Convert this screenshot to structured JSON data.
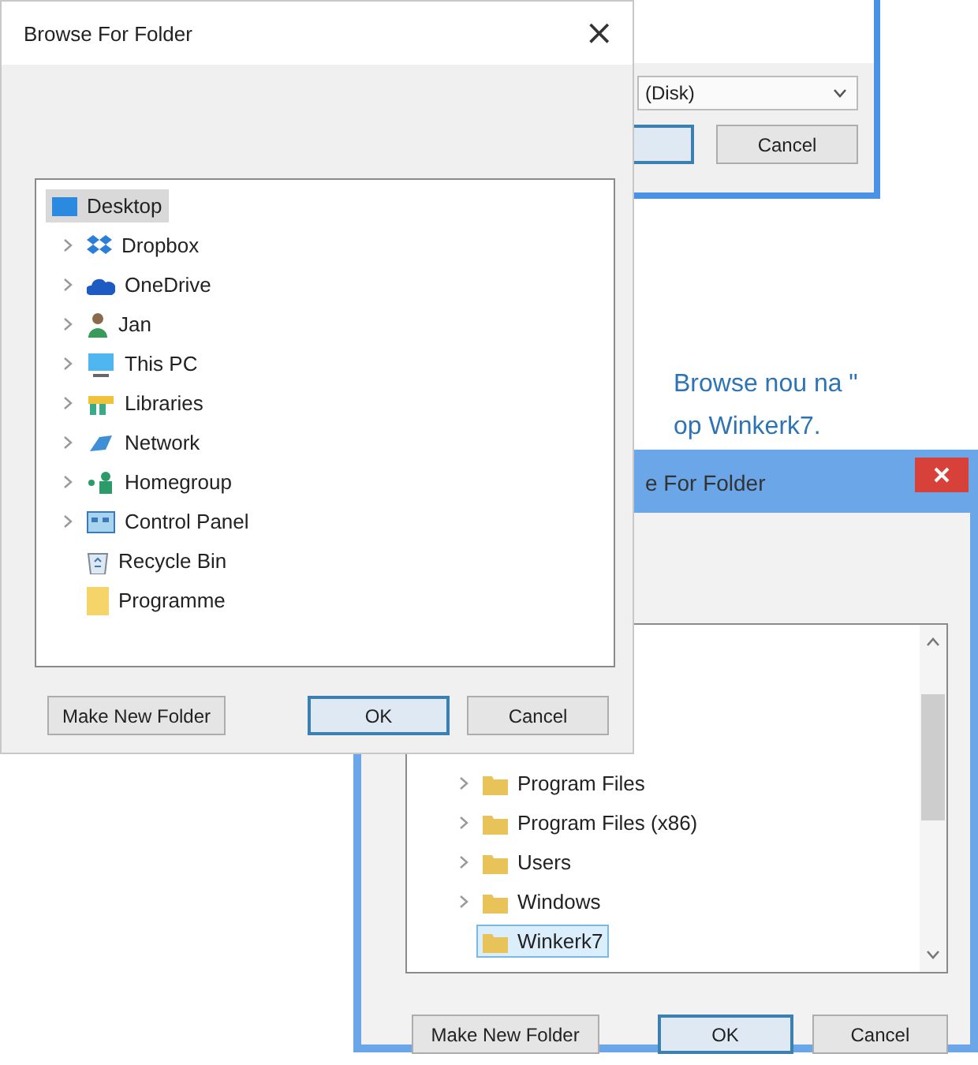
{
  "background_dialog": {
    "drive_field": "(Disk)",
    "cancel_button": "Cancel"
  },
  "dialog": {
    "title": "Browse For Folder",
    "close": "×",
    "tree": [
      {
        "label": "Desktop",
        "kind": "desktop",
        "selected": true,
        "expandable": false,
        "children": [
          {
            "label": "Dropbox",
            "kind": "dropbox",
            "selected": false,
            "expandable": true
          },
          {
            "label": "OneDrive",
            "kind": "cloud",
            "selected": false,
            "expandable": true
          },
          {
            "label": "Jan",
            "kind": "user",
            "selected": false,
            "expandable": true
          },
          {
            "label": "This PC",
            "kind": "pc",
            "selected": false,
            "expandable": true
          },
          {
            "label": "Libraries",
            "kind": "libraries",
            "selected": false,
            "expandable": true
          },
          {
            "label": "Network",
            "kind": "network",
            "selected": false,
            "expandable": true
          },
          {
            "label": "Homegroup",
            "kind": "homegroup",
            "selected": false,
            "expandable": true
          },
          {
            "label": "Control Panel",
            "kind": "control-panel",
            "selected": false,
            "expandable": true
          },
          {
            "label": "Recycle Bin",
            "kind": "recycle-bin",
            "selected": false,
            "expandable": false
          },
          {
            "label": "Programme",
            "kind": "folder",
            "selected": false,
            "expandable": false
          }
        ]
      }
    ],
    "buttons": [
      {
        "label": "Make New Folder",
        "default": false
      },
      {
        "label": "OK",
        "default": true
      },
      {
        "label": "Cancel",
        "default": false
      }
    ]
  },
  "instruction": [
    "Browse nou na \"",
    "op Winkerk7."
  ],
  "second_dialog": {
    "title": "e For Folder",
    "tree": [
      {
        "label": "Program Files",
        "kind": "folder",
        "selected": false,
        "expandable": true
      },
      {
        "label": "Program Files (x86)",
        "kind": "folder",
        "selected": false,
        "expandable": true
      },
      {
        "label": "Users",
        "kind": "folder",
        "selected": false,
        "expandable": true
      },
      {
        "label": "Windows",
        "kind": "folder",
        "selected": false,
        "expandable": true
      },
      {
        "label": "Winkerk7",
        "kind": "folder",
        "selected": true,
        "expandable": false
      }
    ],
    "buttons": [
      {
        "label": "Make New Folder",
        "default": false
      },
      {
        "label": "OK",
        "default": true
      },
      {
        "label": "Cancel",
        "default": false
      }
    ]
  }
}
